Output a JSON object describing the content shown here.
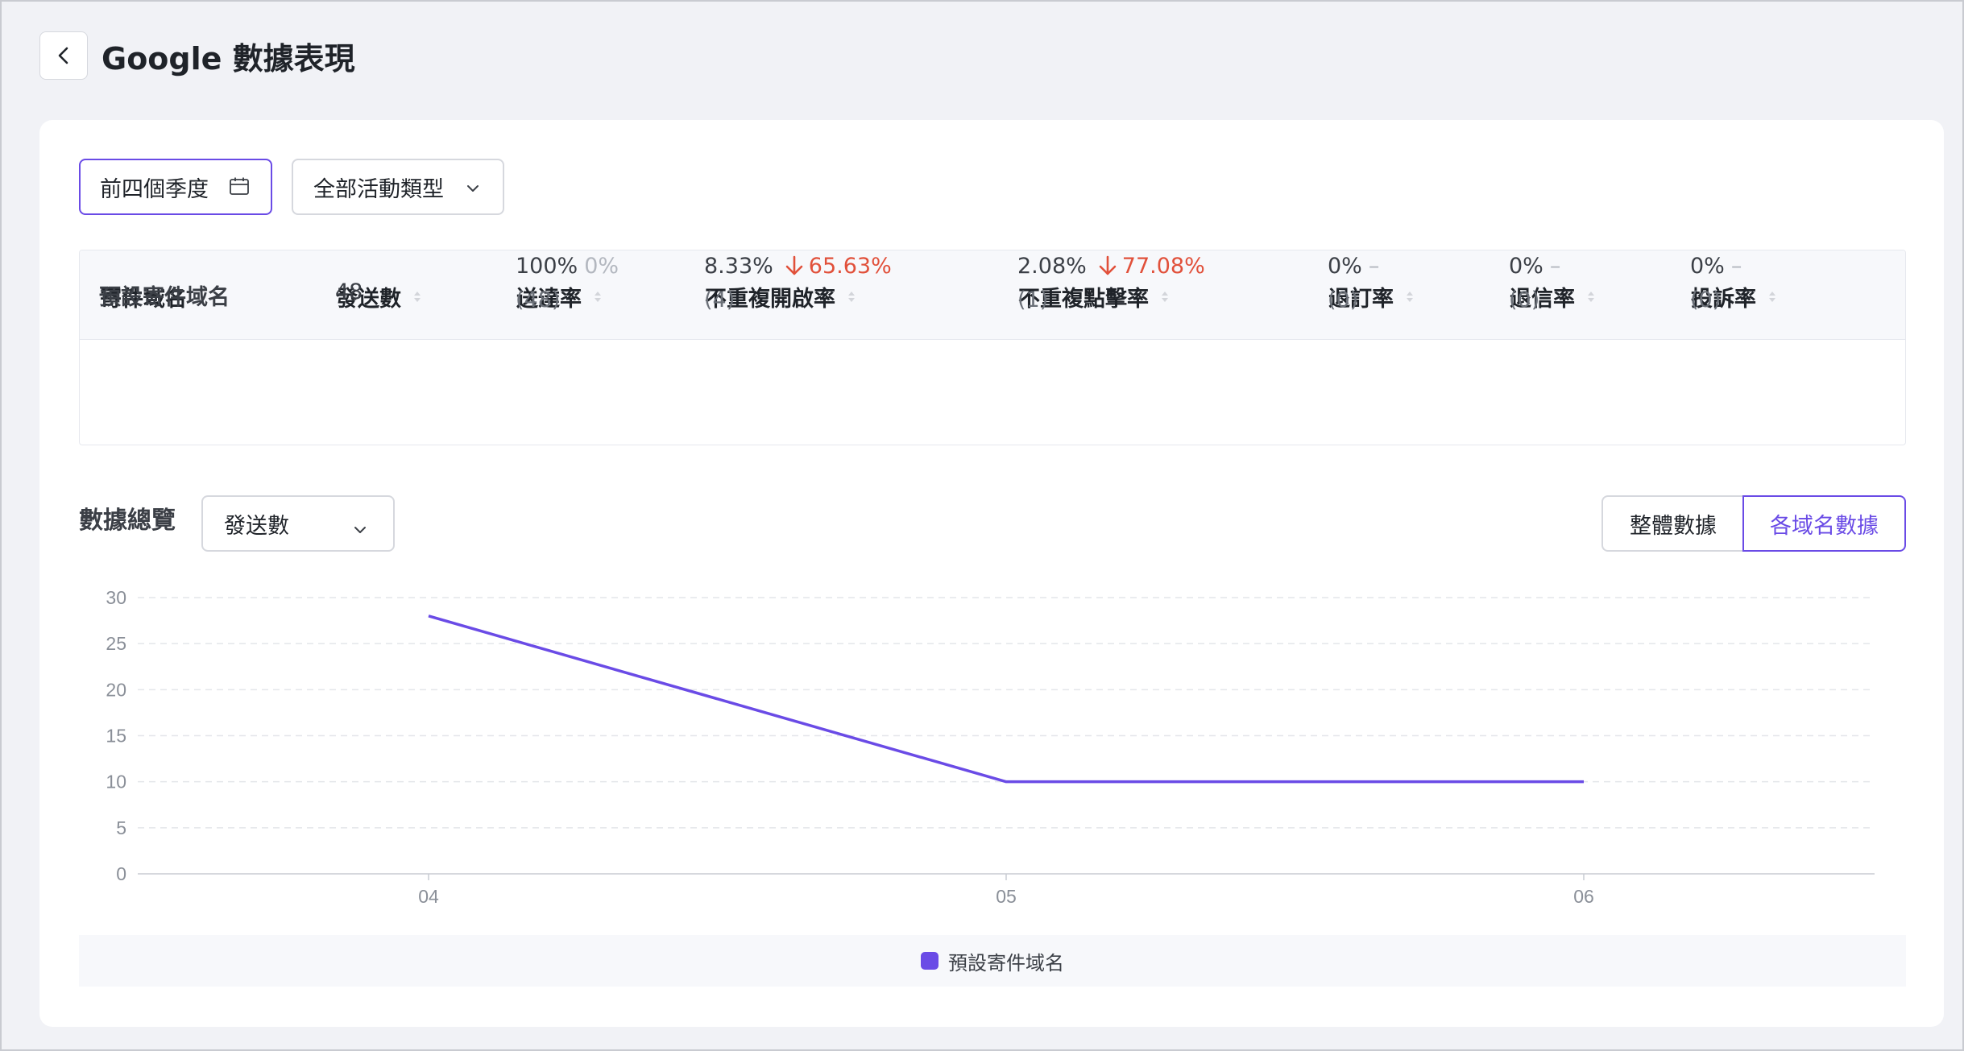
{
  "header": {
    "title": "Google 數據表現"
  },
  "filters": {
    "date_range": "前四個季度",
    "activity_type": "全部活動類型"
  },
  "table": {
    "columns": [
      "寄件域名",
      "發送數",
      "送達率",
      "不重複開啟率",
      "不重複點擊率",
      "退訂率",
      "退信率",
      "投訴率"
    ],
    "row": {
      "domain": "預設寄件域名",
      "sent": "48",
      "delivery": {
        "rate": "100%",
        "change": "0%",
        "count": "(48)"
      },
      "open": {
        "rate": "8.33%",
        "change": "65.63%",
        "count": "(4)"
      },
      "click": {
        "rate": "2.08%",
        "change": "77.08%",
        "count": "(1)"
      },
      "unsub": {
        "rate": "0%",
        "change": "–",
        "count": "(0)"
      },
      "bounce": {
        "rate": "0%",
        "change": "–",
        "count": "(0)"
      },
      "complaint": {
        "rate": "0%",
        "change": "–",
        "count": "(0)"
      }
    }
  },
  "overview": {
    "title": "數據總覽",
    "metric": "發送數",
    "view_overall": "整體數據",
    "view_by_domain": "各域名數據"
  },
  "colors": {
    "accent": "#6a4be6",
    "down": "#e1503a"
  },
  "chart_data": {
    "type": "line",
    "x": [
      "04",
      "05",
      "06"
    ],
    "series": [
      {
        "name": "預設寄件域名",
        "values": [
          28,
          10,
          10
        ],
        "color": "#6a4be6"
      }
    ],
    "yticks": [
      "0",
      "5",
      "10",
      "15",
      "20",
      "25",
      "30"
    ],
    "ylim": [
      0,
      30
    ],
    "grid": true,
    "legend": "bottom"
  }
}
